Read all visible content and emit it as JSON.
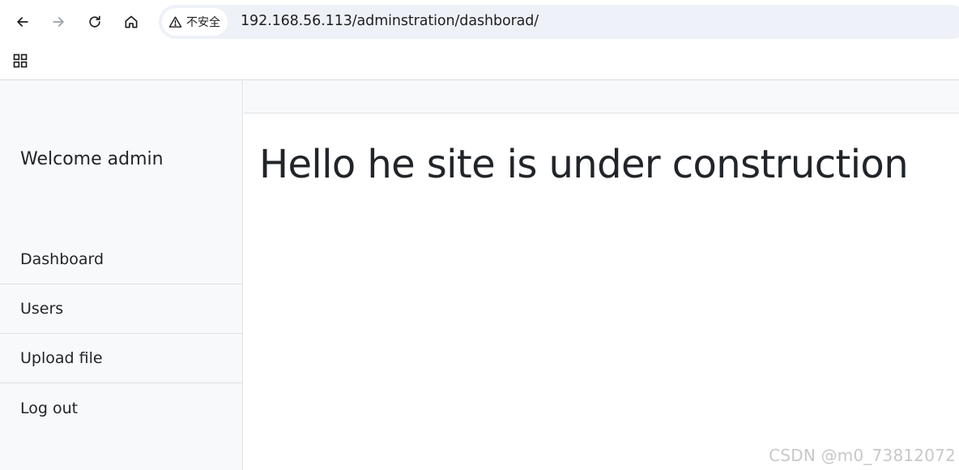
{
  "browser": {
    "security_label": "不安全",
    "url": "192.168.56.113/adminstration/dashborad/",
    "icons": {
      "back": "arrow-left-icon",
      "forward": "arrow-right-icon",
      "reload": "reload-icon",
      "home": "home-icon",
      "security": "warning-triangle-icon",
      "apps": "apps-grid-icon"
    }
  },
  "sidebar": {
    "welcome": "Welcome admin",
    "items": [
      {
        "label": "Dashboard"
      },
      {
        "label": "Users"
      },
      {
        "label": "Upload file"
      },
      {
        "label": "Log out"
      }
    ]
  },
  "main": {
    "headline": "Hello he site is under construction"
  },
  "watermark": "CSDN @m0_73812072",
  "colors": {
    "sidebar_bg": "#f8f9fa",
    "border": "#dee2e6",
    "text": "#212529",
    "omnibox_bg": "#eef1f8"
  }
}
